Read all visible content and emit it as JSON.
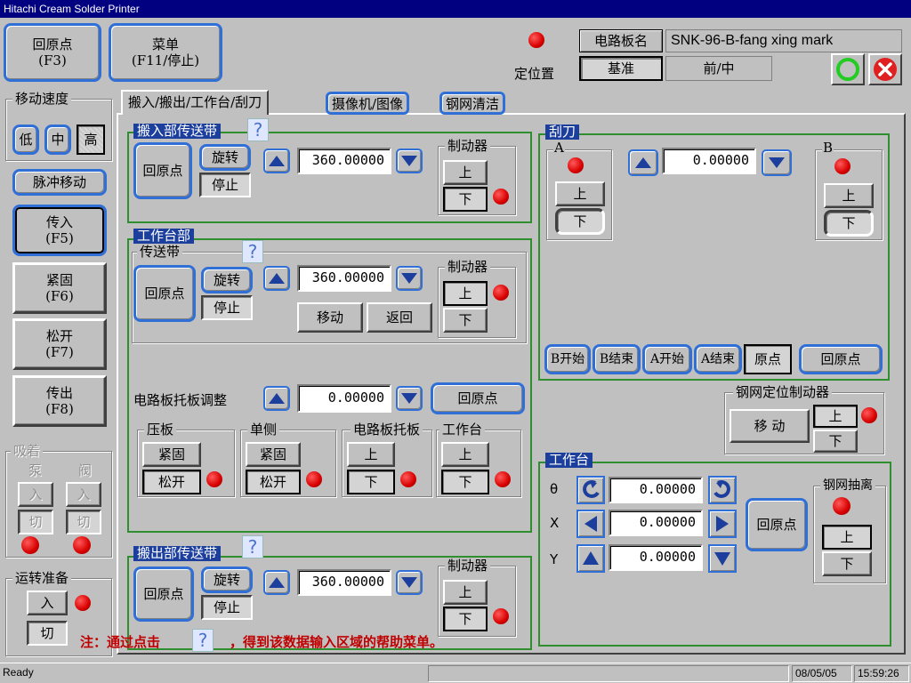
{
  "app": {
    "title": "Hitachi Cream Solder Printer"
  },
  "top": {
    "home_label": "回原点\n(F3)",
    "menu_label": "菜单\n(F11/停止)",
    "position_label": "定位置",
    "board_name_label": "电路板名",
    "board_name_value": "SNK-96-B-fang xing mark",
    "ref_label": "基准",
    "front_mid": "前/中"
  },
  "speed": {
    "title": "移动速度",
    "low": "低",
    "mid": "中",
    "high": "高"
  },
  "left": {
    "pulse_move": "脉冲移动",
    "carry_in": "传入\n(F5)",
    "clamp": "紧固\n(F6)",
    "release": "松开\n(F7)",
    "carry_out": "传出\n(F8)"
  },
  "suction": {
    "title": "吸着",
    "pump": "泵",
    "valve": "阀",
    "in": "入",
    "off": "切"
  },
  "ready": {
    "title": "运转准备",
    "in": "入",
    "off": "切"
  },
  "tabs": {
    "t1": "搬入/搬出/工作台/刮刀",
    "t2": "摄像机/图像",
    "t3": "钢网清洁"
  },
  "common": {
    "home": "回原点",
    "rotate": "旋转",
    "stop": "停止",
    "brake": "制动器",
    "up": "上",
    "down": "下",
    "help": "?",
    "origin": "原点"
  },
  "carry_in_conv": {
    "title": "搬入部传送带",
    "value": "360.00000"
  },
  "table_section": {
    "title": "工作台部",
    "conv_title": "传送带",
    "conv_value": "360.00000",
    "move": "移动",
    "return": "返回",
    "support_label": "电路板托板调整",
    "support_value": "0.00000",
    "press_title": "压板",
    "single_title": "单侧",
    "board_support_title": "电路板托板",
    "table_title": "工作台",
    "clamp": "紧固",
    "release": "松开"
  },
  "carry_out_conv": {
    "title": "搬出部传送带",
    "value": "360.00000"
  },
  "squeegee": {
    "title": "刮刀",
    "a": "A",
    "b": "B",
    "value": "0.00000",
    "b_start": "B开始",
    "b_end": "B结束",
    "a_start": "A开始",
    "a_end": "A结束"
  },
  "stencil_brake": {
    "title": "钢网定位制动器",
    "move": "移  动"
  },
  "worktable": {
    "title": "工作台",
    "theta": "θ",
    "x": "X",
    "y": "Y",
    "theta_value": "0.00000",
    "x_value": "0.00000",
    "y_value": "0.00000",
    "stencil_pull": "钢网抽离"
  },
  "note": {
    "prefix": "注：通过点击",
    "suffix": "，得到该数据输入区域的帮助菜单。"
  },
  "status": {
    "left": "Ready",
    "date": "08/05/05",
    "time": "15:59:26"
  },
  "colors": {
    "accent": "#2f6fd6",
    "title_bar": "#000080",
    "led": "#d80000",
    "group_border": "#2f8f2f",
    "note_text": "#c00000"
  }
}
